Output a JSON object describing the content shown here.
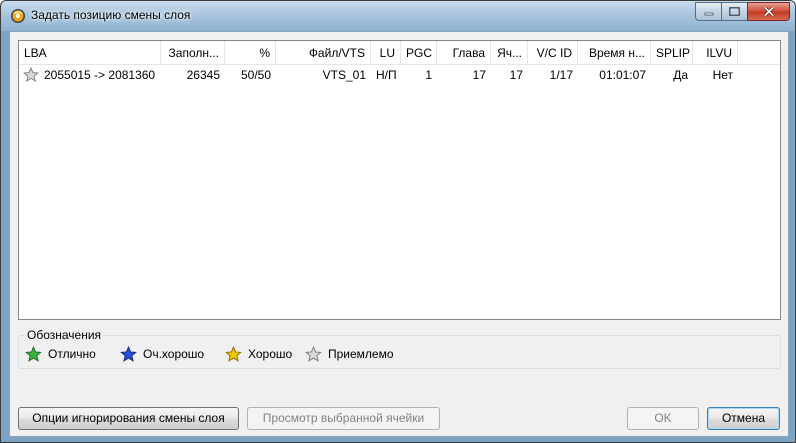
{
  "window": {
    "title": "Задать позицию смены слоя"
  },
  "table": {
    "columns": [
      "LBA",
      "Заполн...",
      "%",
      "Файл/VTS",
      "LU",
      "PGC",
      "Глава",
      "Яч...",
      "V/C ID",
      "Время н...",
      "SPLIP",
      "ILVU"
    ],
    "rows": [
      {
        "icon": "star-gray-icon",
        "cells": [
          "2055015 -> 2081360",
          "26345",
          "50/50",
          "VTS_01",
          "Н/П",
          "1",
          "17",
          "17",
          "1/17",
          "01:01:07",
          "Да",
          "Нет"
        ]
      }
    ]
  },
  "legend": {
    "title": "Обозначения",
    "items": [
      {
        "label": "Отлично",
        "icon": "star-green-icon",
        "color": "#3cb043"
      },
      {
        "label": "Оч.хорошо",
        "icon": "star-blue-icon",
        "color": "#2a4fd6"
      },
      {
        "label": "Хорошо",
        "icon": "star-yellow-icon",
        "color": "#f2c500"
      },
      {
        "label": "Приемлемо",
        "icon": "star-gray-icon",
        "color": "#b8b8b8"
      }
    ]
  },
  "buttons": {
    "ignore_options": "Опции игнорирования смены слоя",
    "view_cell": "Просмотр выбранной ячейки",
    "ok": "OK",
    "cancel": "Отмена"
  }
}
